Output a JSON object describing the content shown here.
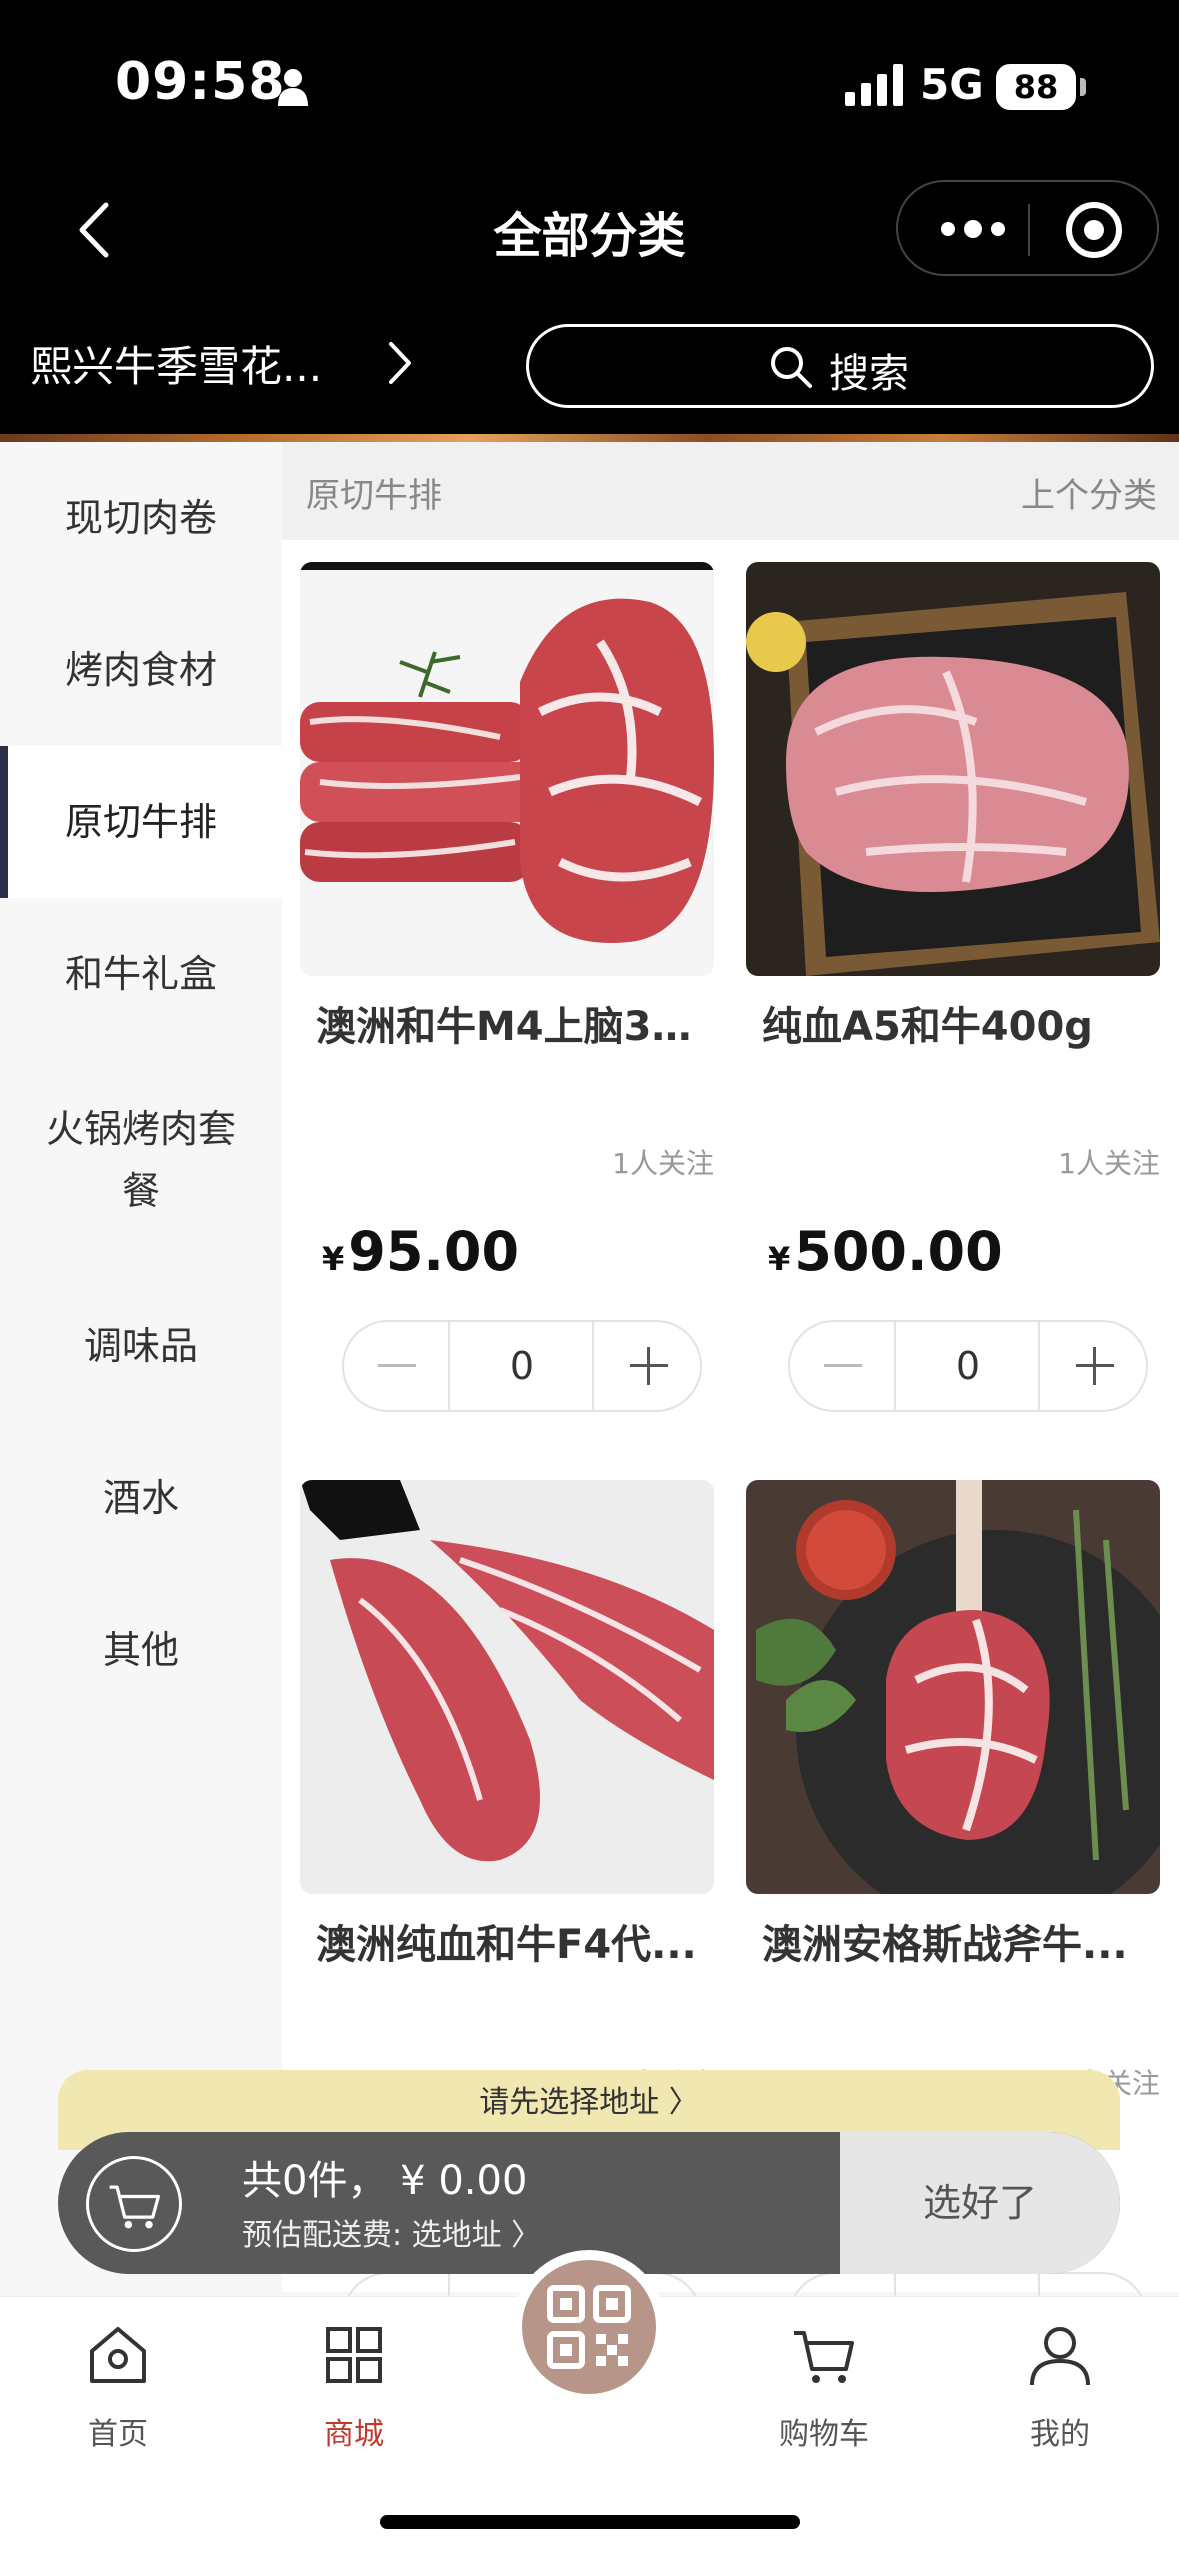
{
  "status_bar": {
    "time": "09:58",
    "network": "5G",
    "battery": "88"
  },
  "header": {
    "title": "全部分类",
    "store_name": "熙兴牛季雪花...",
    "search_label": "搜索"
  },
  "sidebar": {
    "items": [
      {
        "label": "现切肉卷"
      },
      {
        "label": "烤肉食材"
      },
      {
        "label": "原切牛排"
      },
      {
        "label": "和牛礼盒"
      },
      {
        "label": "火锅烤肉套餐"
      },
      {
        "label": "调味品"
      },
      {
        "label": "酒水"
      },
      {
        "label": "其他"
      }
    ],
    "active": "原切牛排"
  },
  "main": {
    "section_title": "原切牛排",
    "prev_label": "上个分类",
    "products": [
      {
        "name": "澳洲和牛M4上脑35...",
        "follow": "1人关注",
        "currency": "¥",
        "price": "95.00",
        "qty": "0"
      },
      {
        "name": "纯血A5和牛400g",
        "follow": "1人关注",
        "currency": "¥",
        "price": "500.00",
        "qty": "0"
      },
      {
        "name": "澳洲纯血和牛F4代...",
        "follow": "1人关注"
      },
      {
        "name": "澳洲安格斯战斧牛...",
        "follow": "1人关注"
      }
    ]
  },
  "cart": {
    "address_notice": "请先选择地址 〉",
    "summary": "共0件，  ¥ 0.00",
    "fee": "预估配送费: 选地址 〉",
    "confirm": "选好了"
  },
  "tabbar": {
    "items": [
      {
        "label": "首页",
        "icon": "home-icon"
      },
      {
        "label": "商城",
        "icon": "grid-icon"
      },
      {
        "label": "购物车",
        "icon": "cart-icon"
      },
      {
        "label": "我的",
        "icon": "user-icon"
      }
    ],
    "active": "商城",
    "center_icon": "qr-scan-icon"
  },
  "colors": {
    "header_bg": "#000000",
    "active_tab": "#c0392b",
    "cart_bar": "#595959",
    "address_notice": "#f1e7b0"
  }
}
